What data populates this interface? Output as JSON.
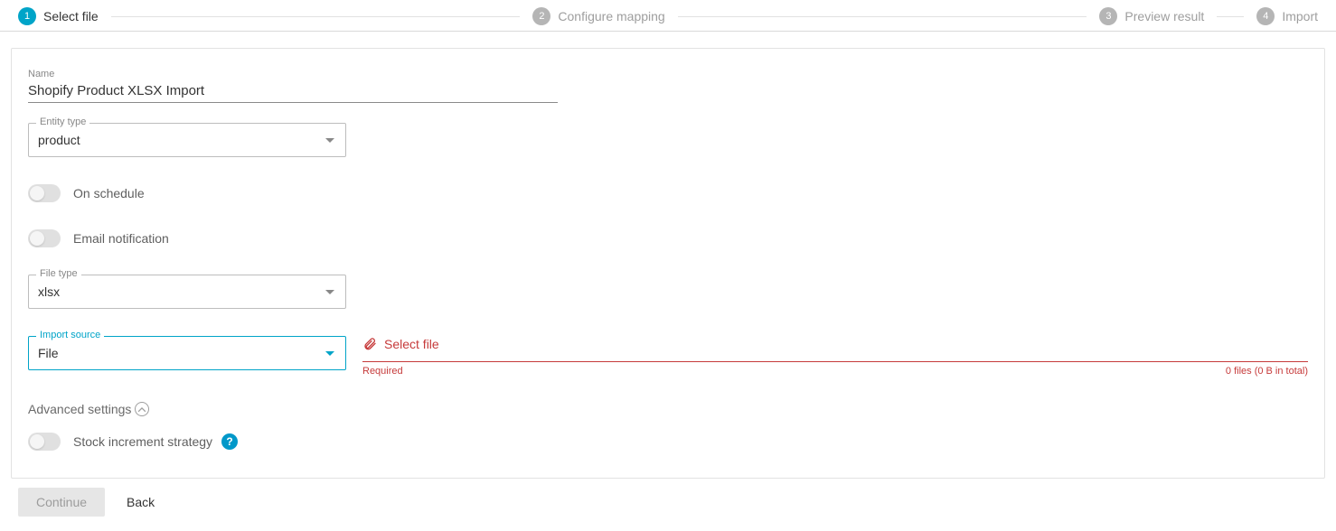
{
  "stepper": {
    "steps": [
      {
        "num": "1",
        "label": "Select file",
        "active": true
      },
      {
        "num": "2",
        "label": "Configure mapping",
        "active": false
      },
      {
        "num": "3",
        "label": "Preview result",
        "active": false
      },
      {
        "num": "4",
        "label": "Import",
        "active": false
      }
    ]
  },
  "form": {
    "name_label": "Name",
    "name_value": "Shopify Product XLSX Import",
    "entity_type": {
      "label": "Entity type",
      "value": "product"
    },
    "on_schedule": {
      "label": "On schedule",
      "on": false
    },
    "email_notification": {
      "label": "Email notification",
      "on": false
    },
    "file_type": {
      "label": "File type",
      "value": "xlsx"
    },
    "import_source": {
      "label": "Import source",
      "value": "File"
    },
    "select_file": {
      "link_text": "Select file",
      "required_text": "Required",
      "summary": "0 files (0 B in total)"
    },
    "advanced_label": "Advanced settings",
    "stock_increment": {
      "label": "Stock increment strategy",
      "on": false,
      "help": "?"
    }
  },
  "footer": {
    "continue_label": "Continue",
    "back_label": "Back"
  }
}
